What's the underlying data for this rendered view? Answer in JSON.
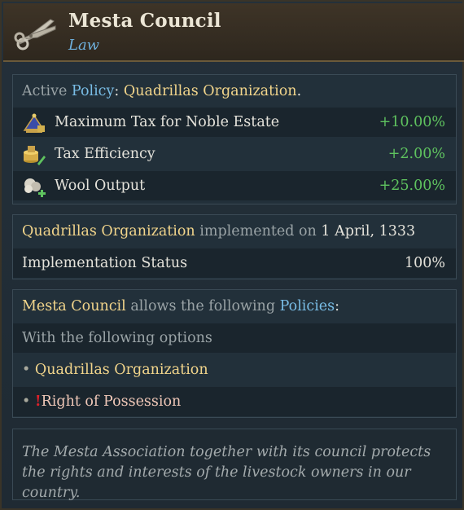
{
  "header": {
    "title": "Mesta Council",
    "subtitle": "Law",
    "icon": "shears-icon"
  },
  "policy_panel": {
    "active_prefix": "Active",
    "policy_word": "Policy",
    "colon": ":",
    "policy_name": "Quadrillas Organization",
    "period": ".",
    "modifiers": [
      {
        "icon": "noble-estate-icon",
        "label": "Maximum Tax for Noble Estate",
        "value": "+10.00%"
      },
      {
        "icon": "tax-efficiency-icon",
        "label": "Tax Efficiency",
        "value": "+2.00%"
      },
      {
        "icon": "wool-icon",
        "label": "Wool Output",
        "value": "+25.00%"
      }
    ]
  },
  "implementation_panel": {
    "policy_name": "Quadrillas Organization",
    "implemented_on": "implemented on",
    "date": "1 April, 1333",
    "status_label": "Implementation Status",
    "status_value": "100%"
  },
  "allowed_panel": {
    "law_name": "Mesta Council",
    "allows_text": "allows the following",
    "policies_word": "Policies",
    "colon": ":",
    "options_text": "With the following options",
    "bullet": "•",
    "options": [
      {
        "name": "Quadrillas Organization",
        "warning": ""
      },
      {
        "name": "Right of Possession",
        "warning": "!"
      }
    ]
  },
  "description": "The Mesta Association together with its council protects the rights and interests of the livestock owners in our country.",
  "colors": {
    "positive": "#5fc35f",
    "gold": "#f2d58b",
    "blue": "#79bde6",
    "warning": "#e0202a"
  }
}
